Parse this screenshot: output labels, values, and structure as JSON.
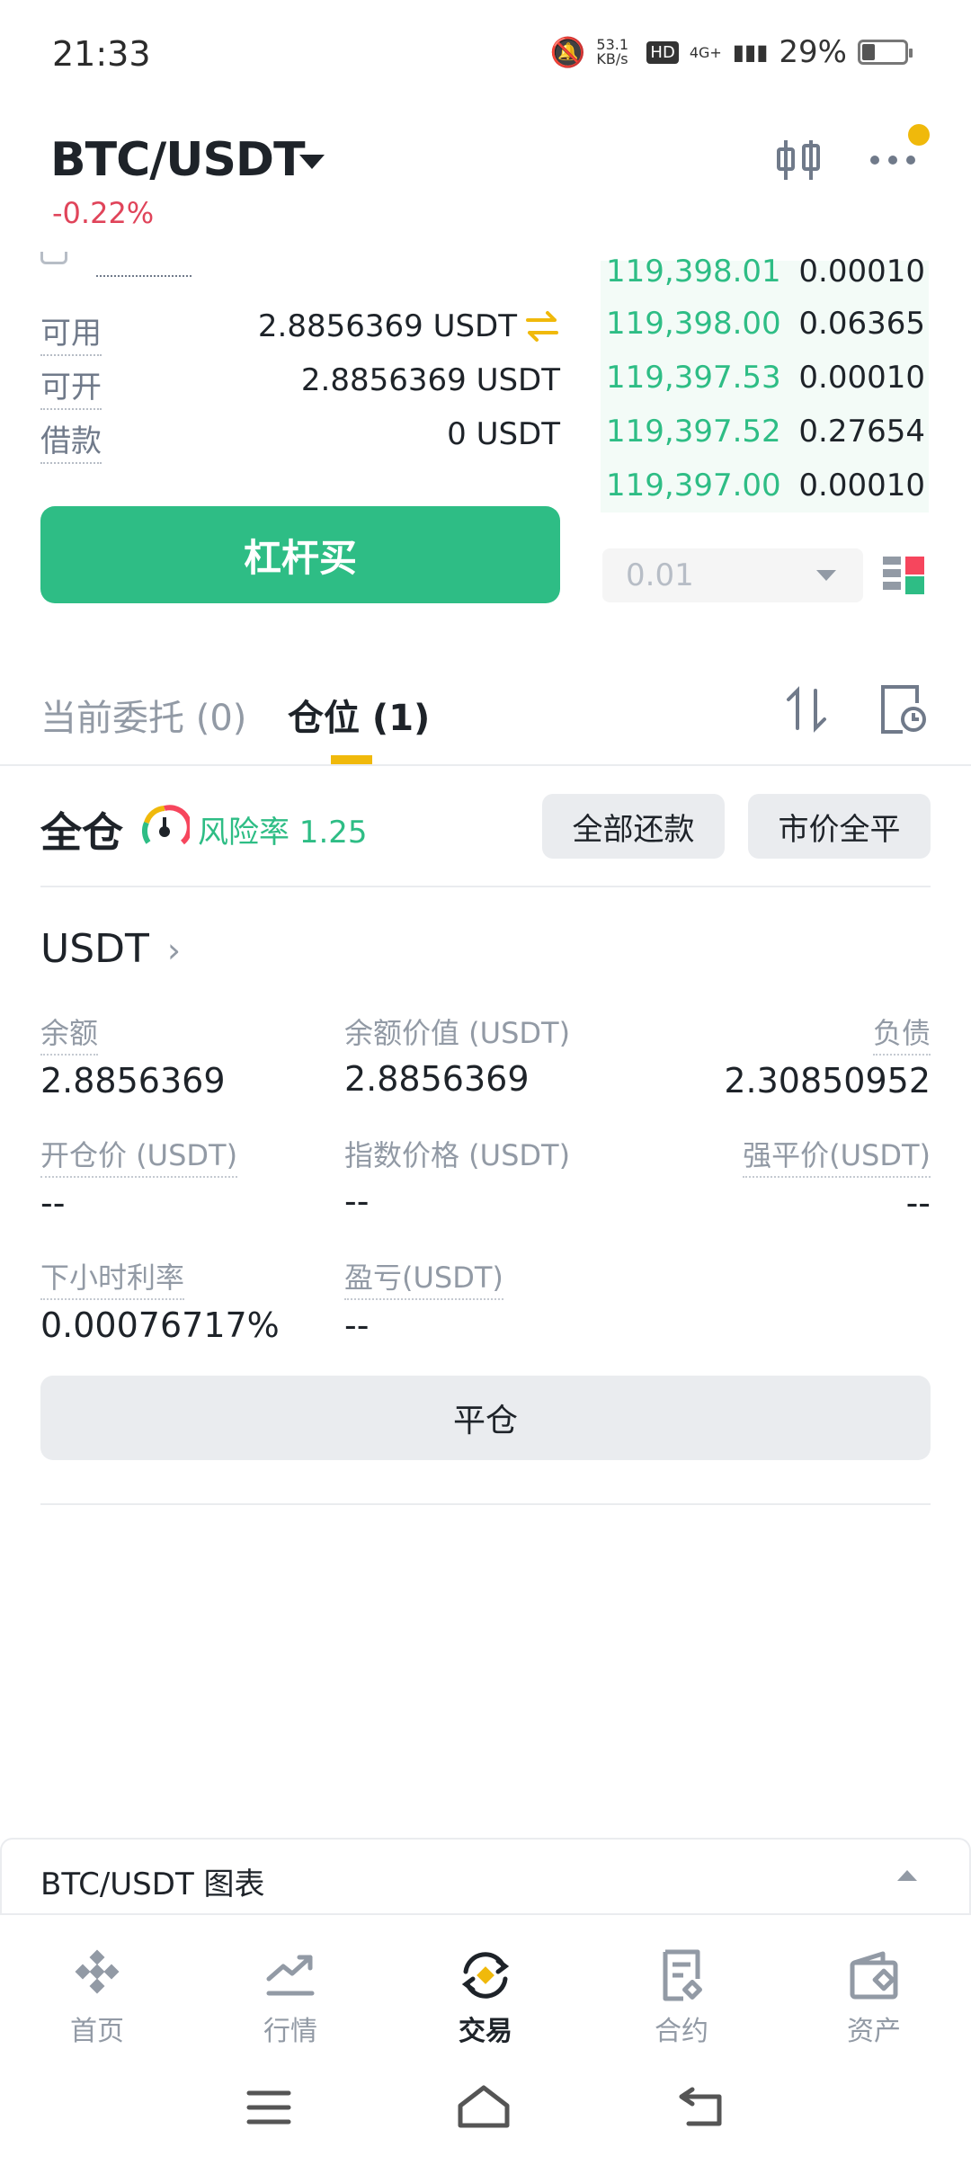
{
  "status_bar": {
    "time": "21:33",
    "net_speed": "53.1 KB/s",
    "hd": "HD",
    "network": "4G+",
    "battery": "29%"
  },
  "header": {
    "pair": "BTC/USDT",
    "change": "-0.22%",
    "change_color": "#e0445a"
  },
  "form": {
    "rows": [
      {
        "label": "可用",
        "value": "2.8856369 USDT"
      },
      {
        "label": "可开",
        "value": "2.8856369 USDT"
      },
      {
        "label": "借款",
        "value": "0 USDT"
      }
    ],
    "buy_button": "杠杆买"
  },
  "order_book": {
    "rows": [
      {
        "price": "119,398.01",
        "qty": "0.00010"
      },
      {
        "price": "119,398.00",
        "qty": "0.06365"
      },
      {
        "price": "119,397.53",
        "qty": "0.00010"
      },
      {
        "price": "119,397.52",
        "qty": "0.27654"
      },
      {
        "price": "119,397.00",
        "qty": "0.00010"
      }
    ],
    "step": "0.01"
  },
  "tabs": [
    {
      "label": "当前委托 (0)",
      "active": false
    },
    {
      "label": "仓位 (1)",
      "active": true
    }
  ],
  "position": {
    "mode": "全仓",
    "risk_label": "风险率 1.25",
    "repay_all": "全部还款",
    "market_close_all": "市价全平",
    "coin": "USDT",
    "fields": [
      {
        "label": "余额",
        "value": "2.8856369"
      },
      {
        "label": "余额价值 (USDT)",
        "value": "2.8856369"
      },
      {
        "label": "负债",
        "value": "2.30850952"
      },
      {
        "label": "开仓价 (USDT)",
        "value": "--"
      },
      {
        "label": "指数价格 (USDT)",
        "value": "--"
      },
      {
        "label": "强平价(USDT)",
        "value": "--"
      },
      {
        "label": "下小时利率",
        "value": "0.00076717%"
      },
      {
        "label": "盈亏(USDT)",
        "value": "--"
      }
    ],
    "close_button": "平仓"
  },
  "chart_bar": {
    "title": "BTC/USDT 图表"
  },
  "bottom_nav": [
    {
      "label": "首页",
      "icon": "home-diamond-icon",
      "active": false
    },
    {
      "label": "行情",
      "icon": "markets-chart-icon",
      "active": false
    },
    {
      "label": "交易",
      "icon": "trade-swap-icon",
      "active": true
    },
    {
      "label": "合约",
      "icon": "futures-doc-icon",
      "active": false
    },
    {
      "label": "资产",
      "icon": "wallet-icon",
      "active": false
    }
  ],
  "colors": {
    "buy": "#2ebd85",
    "sell": "#e0445a",
    "accent": "#f0b90b"
  }
}
